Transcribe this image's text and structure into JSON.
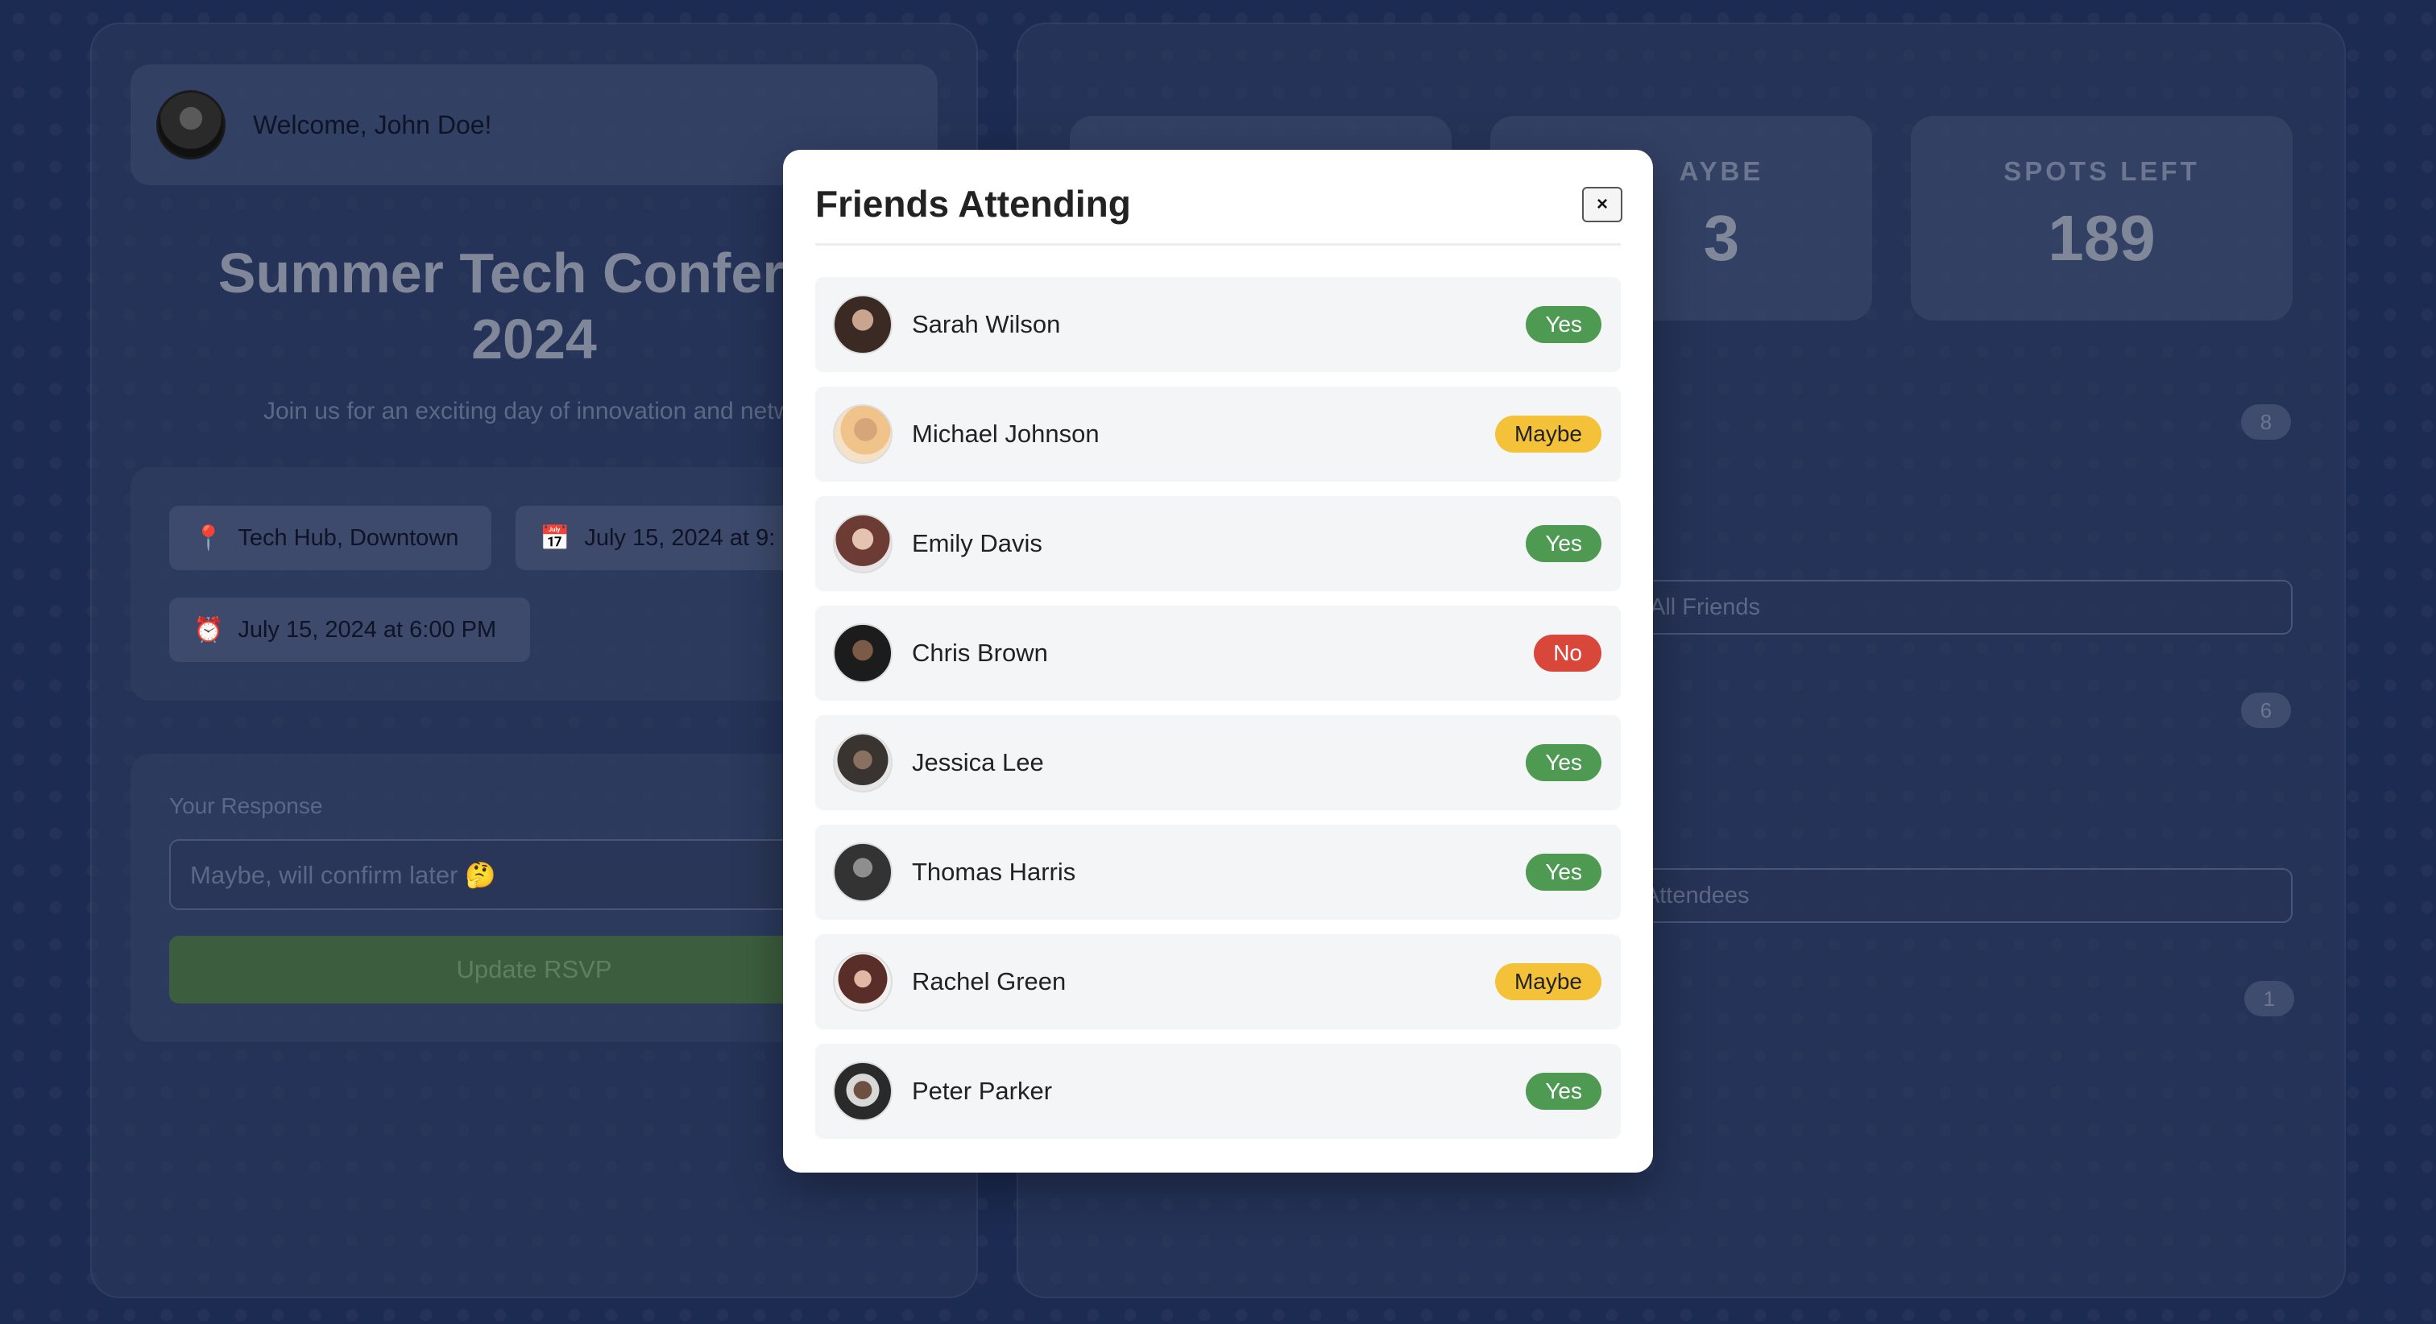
{
  "user": {
    "welcome": "Welcome, John Doe!"
  },
  "event": {
    "title_line1": "Summer Tech Conferen",
    "title_line2": "2024",
    "subtitle": "Join us for an exciting day of innovation and netwo",
    "location": "Tech Hub, Downtown",
    "start": "July 15, 2024 at 9:",
    "end": "July 15, 2024 at 6:00 PM",
    "icons": {
      "location": "pin-icon",
      "start": "calendar-icon",
      "end": "alarm-clock-icon"
    }
  },
  "rsvp": {
    "label": "Your Response",
    "value": "Maybe, will confirm later 🤔",
    "button": "Update RSVP"
  },
  "stats": {
    "maybe_label": "AYBE",
    "maybe_value": "3",
    "spots_label": "SPOTS LEFT",
    "spots_value": "189"
  },
  "sections": {
    "friends_count": "8",
    "friends_button": "All Friends",
    "attendees_count": "6",
    "attendees_button": "l Attendees",
    "no_count": "1"
  },
  "modal": {
    "title": "Friends Attending",
    "close": "×",
    "friends": [
      {
        "name": "Sarah Wilson",
        "status": "Yes",
        "type": "yes"
      },
      {
        "name": "Michael Johnson",
        "status": "Maybe",
        "type": "maybe"
      },
      {
        "name": "Emily Davis",
        "status": "Yes",
        "type": "yes"
      },
      {
        "name": "Chris Brown",
        "status": "No",
        "type": "no"
      },
      {
        "name": "Jessica Lee",
        "status": "Yes",
        "type": "yes"
      },
      {
        "name": "Thomas Harris",
        "status": "Yes",
        "type": "yes"
      },
      {
        "name": "Rachel Green",
        "status": "Maybe",
        "type": "maybe"
      },
      {
        "name": "Peter Parker",
        "status": "Yes",
        "type": "yes"
      }
    ]
  },
  "colors": {
    "yes": "#4e9a53",
    "maybe": "#f4c239",
    "no": "#d9473b",
    "background": "#1c2b52"
  }
}
